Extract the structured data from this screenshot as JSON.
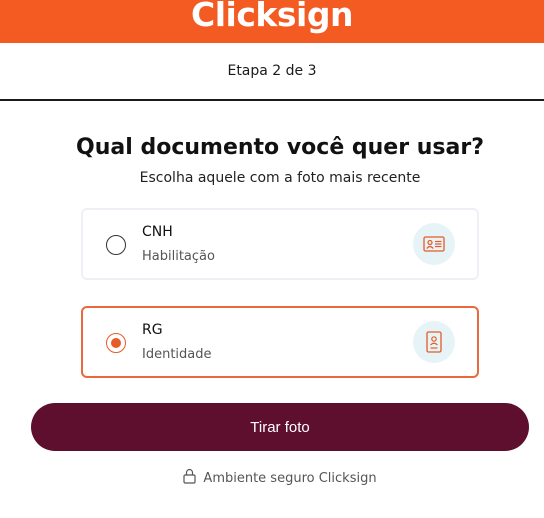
{
  "header": {
    "brand": "Clicksign",
    "brand_color": "#f35b23"
  },
  "progress": {
    "label": "Etapa 2 de 3",
    "current_step": 2,
    "total_steps": 3
  },
  "main": {
    "title": "Qual documento você quer usar?",
    "subtitle": "Escolha aquele com a foto mais recente",
    "options": [
      {
        "title": "CNH",
        "subtitle": "Habilitação",
        "selected": false,
        "icon": "id-card-icon"
      },
      {
        "title": "RG",
        "subtitle": "Identidade",
        "selected": true,
        "icon": "id-badge-icon"
      }
    ],
    "cta_label": "Tirar foto",
    "cta_color": "#5e0f2e",
    "accent_color": "#e85a27"
  },
  "footer": {
    "secure_label": "Ambiente seguro Clicksign",
    "icon": "lock-icon"
  }
}
